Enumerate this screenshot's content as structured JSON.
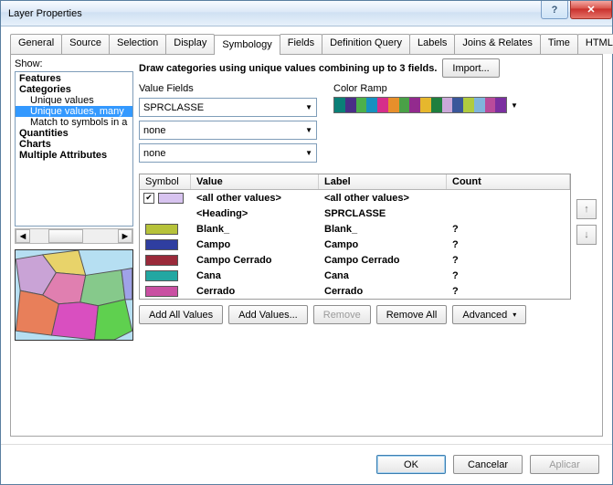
{
  "window": {
    "title": "Layer Properties"
  },
  "tabs": [
    "General",
    "Source",
    "Selection",
    "Display",
    "Symbology",
    "Fields",
    "Definition Query",
    "Labels",
    "Joins & Relates",
    "Time",
    "HTML Popup"
  ],
  "active_tab": "Symbology",
  "left": {
    "show_label": "Show:",
    "tree": [
      {
        "label": "Features",
        "bold": true
      },
      {
        "label": "Categories",
        "bold": true
      },
      {
        "label": "Unique values",
        "child": true
      },
      {
        "label": "Unique values, many",
        "child": true,
        "selected": true
      },
      {
        "label": "Match to symbols in a",
        "child": true
      },
      {
        "label": "Quantities",
        "bold": true
      },
      {
        "label": "Charts",
        "bold": true
      },
      {
        "label": "Multiple Attributes",
        "bold": true
      }
    ]
  },
  "right": {
    "draw_text": "Draw categories using unique values combining up to 3 fields.",
    "import_btn": "Import...",
    "value_fields_label": "Value Fields",
    "vf": [
      "SPRCLASSE",
      "none",
      "none"
    ],
    "color_ramp_label": "Color Ramp",
    "ramp_colors": [
      "#0a7f77",
      "#4a2f87",
      "#4cb04a",
      "#1790c0",
      "#d62e8a",
      "#e78f2b",
      "#4aa147",
      "#932a8e",
      "#e6b72d",
      "#1f7f3e",
      "#caa8d8",
      "#3a579a",
      "#b0cb3f",
      "#7fb4dc",
      "#b94b9b",
      "#7b2fa0"
    ],
    "grid": {
      "headers": {
        "symbol": "Symbol",
        "value": "Value",
        "label": "Label",
        "count": "Count"
      },
      "all_other": {
        "value": "<all other values>",
        "label": "<all other values>",
        "checked": true,
        "swatch": "#d7c3ef"
      },
      "heading": {
        "value": "<Heading>",
        "label": "SPRCLASSE"
      },
      "rows": [
        {
          "swatch": "#b6c23a",
          "value": "Blank_",
          "label": "Blank_",
          "count": "?"
        },
        {
          "swatch": "#2f3ea0",
          "value": "Campo",
          "label": "Campo",
          "count": "?"
        },
        {
          "swatch": "#9a2a3a",
          "value": "Campo Cerrado",
          "label": "Campo Cerrado",
          "count": "?"
        },
        {
          "swatch": "#22a7a2",
          "value": "Cana",
          "label": "Cana",
          "count": "?"
        },
        {
          "swatch": "#c94fa2",
          "value": "Cerrado",
          "label": "Cerrado",
          "count": "?"
        }
      ]
    },
    "buttons": {
      "add_all": "Add All Values",
      "add": "Add Values...",
      "remove": "Remove",
      "remove_all": "Remove All",
      "advanced": "Advanced"
    }
  },
  "footer": {
    "ok": "OK",
    "cancel": "Cancelar",
    "apply": "Aplicar"
  }
}
